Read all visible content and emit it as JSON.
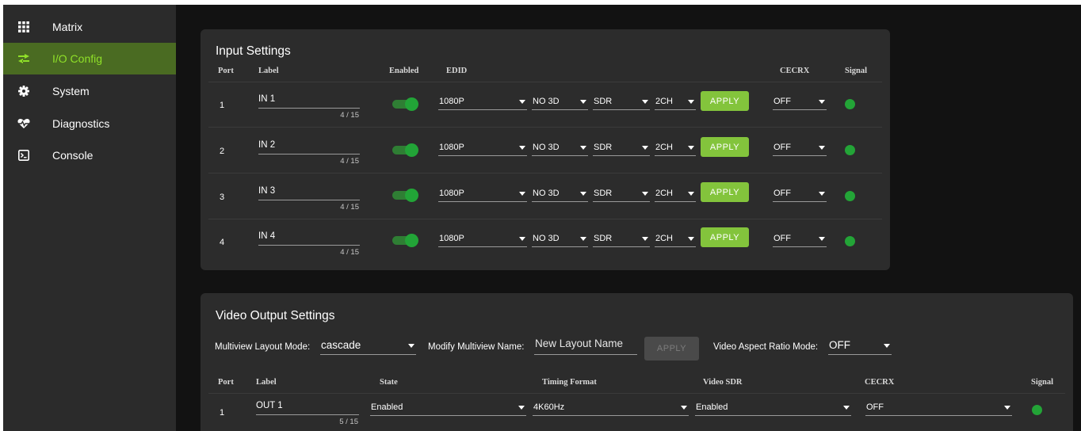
{
  "sidebar": {
    "items": [
      {
        "label": "Matrix",
        "icon": "grid-icon",
        "active": false
      },
      {
        "label": "I/O Config",
        "icon": "swap-arrows-icon",
        "active": true
      },
      {
        "label": "System",
        "icon": "gear-icon",
        "active": false
      },
      {
        "label": "Diagnostics",
        "icon": "heart-pulse-icon",
        "active": false
      },
      {
        "label": "Console",
        "icon": "terminal-icon",
        "active": false
      }
    ]
  },
  "colors": {
    "accent_green": "#8fe028",
    "active_nav_bg": "#4a6b22",
    "apply_button": "#83c43c",
    "signal_on": "#23a437",
    "toggle_on": "#22a437"
  },
  "input_settings": {
    "title": "Input Settings",
    "headers": {
      "port": "Port",
      "label": "Label",
      "enabled": "Enabled",
      "edid": "EDID",
      "cecrx": "CECRX",
      "signal": "Signal"
    },
    "apply_label": "APPLY",
    "rows": [
      {
        "port": "1",
        "label": "IN 1",
        "counter": "4 / 15",
        "enabled": true,
        "resolution": "1080P",
        "mode3d": "NO 3D",
        "range": "SDR",
        "audio": "2CH",
        "cecrx": "OFF",
        "signal": true
      },
      {
        "port": "2",
        "label": "IN 2",
        "counter": "4 / 15",
        "enabled": true,
        "resolution": "1080P",
        "mode3d": "NO 3D",
        "range": "SDR",
        "audio": "2CH",
        "cecrx": "OFF",
        "signal": true
      },
      {
        "port": "3",
        "label": "IN 3",
        "counter": "4 / 15",
        "enabled": true,
        "resolution": "1080P",
        "mode3d": "NO 3D",
        "range": "SDR",
        "audio": "2CH",
        "cecrx": "OFF",
        "signal": true
      },
      {
        "port": "4",
        "label": "IN 4",
        "counter": "4 / 15",
        "enabled": true,
        "resolution": "1080P",
        "mode3d": "NO 3D",
        "range": "SDR",
        "audio": "2CH",
        "cecrx": "OFF",
        "signal": true
      }
    ]
  },
  "output_settings": {
    "title": "Video Output Settings",
    "multiview_label": "Multiview Layout Mode:",
    "multiview_value": "cascade",
    "modify_label": "Modify Multiview Name:",
    "modify_placeholder": "New Layout Name",
    "apply_label": "APPLY",
    "aspect_label": "Video Aspect Ratio Mode:",
    "aspect_value": "OFF",
    "headers": {
      "port": "Port",
      "label": "Label",
      "state": "State",
      "timing": "Timing Format",
      "sdr": "Video SDR",
      "cecrx": "CECRX",
      "signal": "Signal"
    },
    "rows": [
      {
        "port": "1",
        "label": "OUT 1",
        "counter": "5 / 15",
        "state": "Enabled",
        "timing": "4K60Hz",
        "sdr": "Enabled",
        "cecrx": "OFF",
        "signal": true
      }
    ]
  }
}
